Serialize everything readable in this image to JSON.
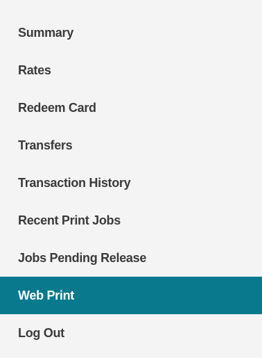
{
  "nav": {
    "items": [
      {
        "label": "Summary"
      },
      {
        "label": "Rates"
      },
      {
        "label": "Redeem Card"
      },
      {
        "label": "Transfers"
      },
      {
        "label": "Transaction History"
      },
      {
        "label": "Recent Print Jobs"
      },
      {
        "label": "Jobs Pending Release"
      },
      {
        "label": "Web Print",
        "active": true
      },
      {
        "label": "Log Out"
      }
    ],
    "active_color": "#097a8e"
  }
}
